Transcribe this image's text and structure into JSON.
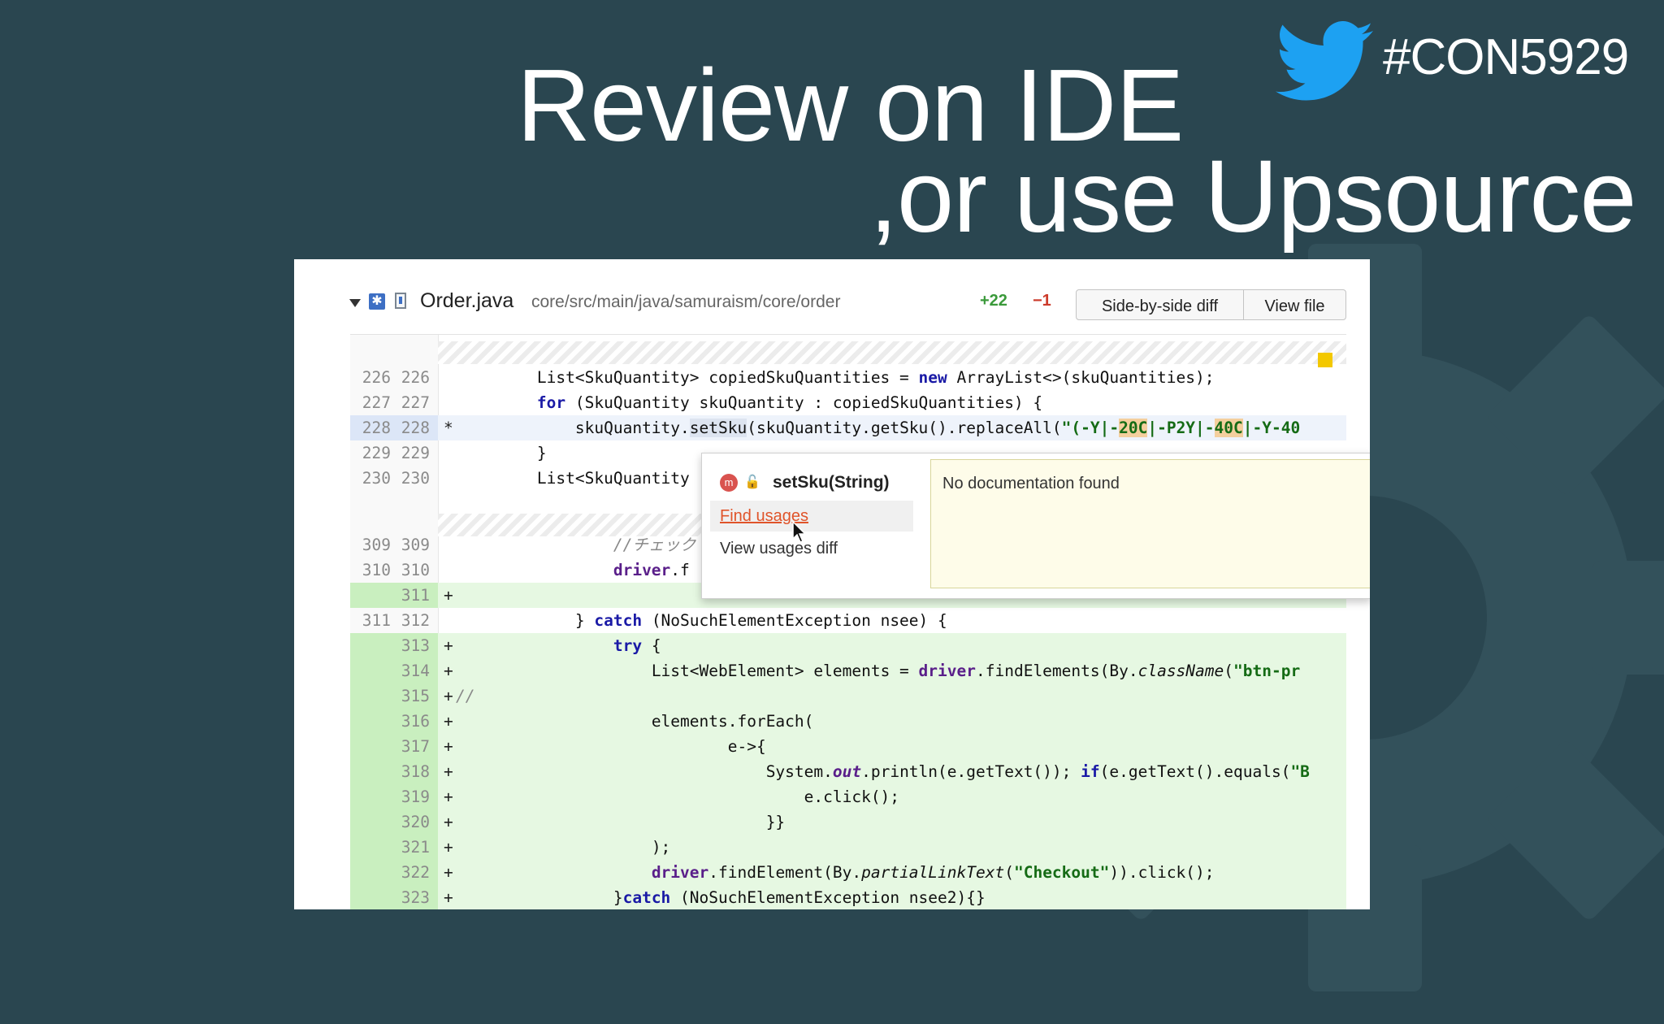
{
  "slide": {
    "title_line1": "Review on IDE",
    "title_line2": ",or use Upsource",
    "hashtag": "#CON5929",
    "icons": [
      "twitter-bird-icon",
      "gear-background-icon"
    ]
  },
  "colors": {
    "background": "#2a4650",
    "added_line": "#e6f8e2",
    "added_gutter": "#c9efbf",
    "keyword": "#1a1aa6",
    "string": "#156b15",
    "field": "#5a1f8a",
    "added_count": "#3b9a3b",
    "removed_count": "#cc3b2b",
    "find_usages": "#e0542a",
    "marker": "#f3c800"
  },
  "file": {
    "name": "Order.java",
    "path": "core/src/main/java/samuraism/core/order",
    "added": "+22",
    "removed": "−1",
    "buttons": {
      "side_by_side": "Side-by-side diff",
      "view_file": "View file"
    }
  },
  "diff": {
    "lines": [
      {
        "old": "226",
        "new": "226",
        "mark": ""
      },
      {
        "old": "227",
        "new": "227",
        "mark": ""
      },
      {
        "old": "228",
        "new": "228",
        "mark": "*"
      },
      {
        "old": "229",
        "new": "229",
        "mark": ""
      },
      {
        "old": "230",
        "new": "230",
        "mark": ""
      },
      {
        "old": "309",
        "new": "309",
        "mark": ""
      },
      {
        "old": "310",
        "new": "310",
        "mark": ""
      },
      {
        "old": "",
        "new": "311",
        "mark": "+"
      },
      {
        "old": "311",
        "new": "312",
        "mark": ""
      },
      {
        "old": "",
        "new": "313",
        "mark": "+"
      },
      {
        "old": "",
        "new": "314",
        "mark": "+"
      },
      {
        "old": "",
        "new": "315",
        "mark": "+"
      },
      {
        "old": "",
        "new": "316",
        "mark": "+"
      },
      {
        "old": "",
        "new": "317",
        "mark": "+"
      },
      {
        "old": "",
        "new": "318",
        "mark": "+"
      },
      {
        "old": "",
        "new": "319",
        "mark": "+"
      },
      {
        "old": "",
        "new": "320",
        "mark": "+"
      },
      {
        "old": "",
        "new": "321",
        "mark": "+"
      },
      {
        "old": "",
        "new": "322",
        "mark": "+"
      },
      {
        "old": "",
        "new": "323",
        "mark": "+"
      }
    ],
    "code": {
      "l226": [
        "List<SkuQuantity> copiedSkuQuantities = ",
        "new",
        " ArrayList<>(skuQuantities);"
      ],
      "l227": [
        "for",
        " (SkuQuantity skuQuantity : copiedSkuQuantities) {"
      ],
      "l228": [
        "skuQuantity.",
        "setSku",
        "(skuQuantity.getSku().replaceAll(",
        "\"(-Y|-",
        "20C",
        "|-P2Y|-",
        "40C",
        "|-Y-40"
      ],
      "l229": [
        "}"
      ],
      "l230": [
        "List<SkuQuantity"
      ],
      "l309": [
        "//チェック"
      ],
      "l310": [
        "driver",
        ".f"
      ],
      "l312": [
        "} ",
        "catch",
        " (NoSuchElementException nsee) {"
      ],
      "l313": [
        "try",
        " {"
      ],
      "l314": [
        "List<WebElement> elements = ",
        "driver",
        ".findElements(By.",
        "className",
        "(",
        "\"btn-pr"
      ],
      "l315": [
        "//"
      ],
      "l316": [
        "elements.forEach("
      ],
      "l317": [
        "e->{"
      ],
      "l318": [
        "System.",
        "out",
        ".println(e.getText()); ",
        "if",
        "(e.getText().equals(",
        "\"B"
      ],
      "l319": [
        "e.click();"
      ],
      "l320": [
        "}}"
      ],
      "l321": [
        ");"
      ],
      "l322": [
        "driver",
        ".findElement(By.",
        "partialLinkText",
        "(",
        "\"Checkout\"",
        ")).click();"
      ],
      "l323": [
        "}",
        "catch",
        " (NoSuchElementException nsee2){}"
      ]
    }
  },
  "popup": {
    "signature": "setSku(String)",
    "method_badge": "m",
    "find_usages": "Find usages",
    "view_usages_diff": "View usages diff",
    "documentation": "No documentation found"
  }
}
